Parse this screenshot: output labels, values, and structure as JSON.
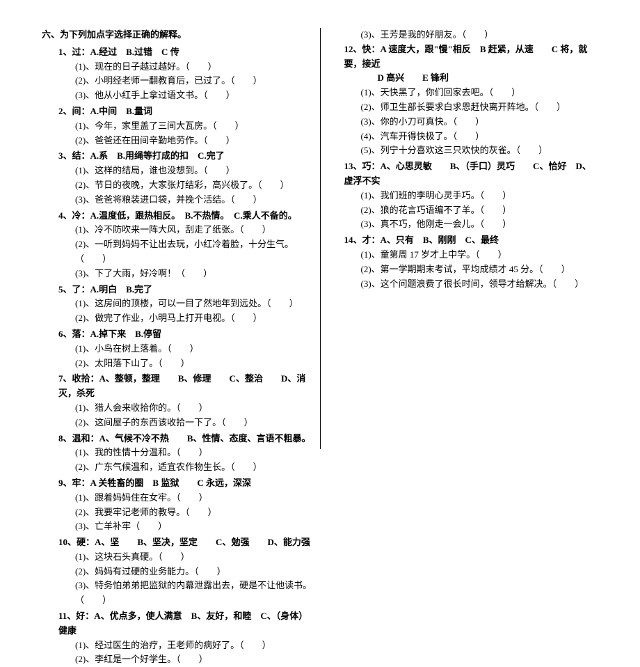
{
  "section_title": "六、为下列加点字选择正确的解释。",
  "questions": [
    {
      "num": "1、",
      "head": "过：A.经过　B.过错　C 传",
      "subs": [
        "(1)、现在的日子越过越好。（　　）",
        "(2)、小明经老师一翻教育后，已过了。（　　）",
        "(3)、他从小红手上拿过语文书。（　　）"
      ]
    },
    {
      "num": "2、",
      "head": "间：A.中间　B.量词",
      "subs": [
        "(1)、今年，家里盖了三间大瓦房。（　　）",
        "(2)、爸爸还在田间辛勤地劳作。（　　）"
      ]
    },
    {
      "num": "3、",
      "head": "结：A.系　B.用绳等打成的扣　C.完了",
      "subs": [
        "(1)、这样的结局，谁也没想到。（　　）",
        "(2)、节日的夜晚，大家张灯结彩，高兴极了。（　　）",
        "(3)、爸爸将粮装进口袋，并挽个活结。（　　）"
      ]
    },
    {
      "num": "4、",
      "head": "冷：A.温度低，跟热相反。　B.不热情。　C.乘人不备的。",
      "subs": [
        "(1)、冷不防吹来一阵大风，刮走了纸张。（　　）",
        "(2)、一听到妈妈不让出去玩，小红冷着脸，十分生气。（　　）",
        "(3)、下了大雨，好冷啊！（　　）"
      ]
    },
    {
      "num": "5、",
      "head": "了：A.明白　B.完了",
      "subs": [
        "(1)、这房间的顶楼，可以一目了然地年到远处。（　　）",
        "(2)、做完了作业，小明马上打开电视。（　　）"
      ]
    },
    {
      "num": "6、",
      "head": "落：A.掉下来　B.停留",
      "subs": [
        "(1)、小鸟在树上落着。（　　）",
        "(2)、太阳落下山了。（　　）"
      ]
    },
    {
      "num": "7、",
      "head": "收拾：A、整顿，整理　　B、修理　　C、整治　　D、消灭，杀死",
      "subs": [
        "(1)、猎人会来收拾你的。（　　）",
        "(2)、这间屋子的东西该收拾一下了。（　　）"
      ]
    },
    {
      "num": "8、",
      "head": "温和：A、气候不冷不热　　B、性情、态度、言语不粗暴。",
      "subs": [
        "(1)、我的性情十分温和。（　　）",
        "(2)、广东气候温和，适宜农作物生长。（　　）"
      ]
    },
    {
      "num": "9、",
      "head": "牢：A 关牲畜的圈　B 监狱　　C 永远，深深",
      "subs": [
        "(1)、跟着妈妈住在女牢。（　　）",
        "(2)、我要牢记老师的教导。（　　）",
        "(3)、亡羊补牢（　　）"
      ]
    },
    {
      "num": "10、",
      "head": "硬：A、坚　　B、坚决，坚定　　C、勉强　　D、能力强",
      "subs": [
        "(1)、这块石头真硬。（　　）",
        "(2)、妈妈有过硬的业务能力。（　　）",
        "(3)、特务怕弟弟把监狱的内幕泄露出去，硬是不让他读书。（　　）"
      ]
    },
    {
      "num": "11、",
      "head": "好：A、优点多，使人满意　B、友好，和睦　C、（身体）健康",
      "subs": [
        "(1)、经过医生的治疗，王老师的病好了。（　　）",
        "(2)、李红是一个好学生。（　　）",
        "(3)、王芳是我的好朋友。（　　）"
      ]
    },
    {
      "num": "12、",
      "head": "快：A 速度大，跟\"慢\"相反　B 赶紧，从速　　C 将，就要，接近",
      "head2": "D 高兴　　E 锋利",
      "subs": [
        "(1)、天快黑了，你们回家去吧。（　　）",
        "(2)、师卫生部长要求白求恩赶快离开阵地。（　　）",
        "(3)、你的小刀可真快。（　　）",
        "(4)、汽车开得快极了。（　　）",
        "(5)、列宁十分喜欢这三只欢快的灰雀。（　　）"
      ]
    },
    {
      "num": "13、",
      "head": "巧：A、心思灵敏　　B、（手口）灵巧　　C、恰好　D、虚浮不实",
      "subs": [
        "(1)、我们班的李明心灵手巧。（　　）",
        "(2)、狼的花言巧语编不了羊。（　　）",
        "(3)、真不巧，他刚走一会儿。（　　）"
      ]
    },
    {
      "num": "14、",
      "head": "才：A、只有　B、刚刚　C、最终",
      "subs": [
        "(1)、童第周 17 岁才上中学。（　　）",
        "(2)、第一学期期末考试，平均成绩才 45 分。（　　）",
        "(3)、这个问题浪费了很长时间，领导才给解决。（　　）"
      ]
    }
  ],
  "left_count": 11,
  "left_last_sub_count": 2
}
